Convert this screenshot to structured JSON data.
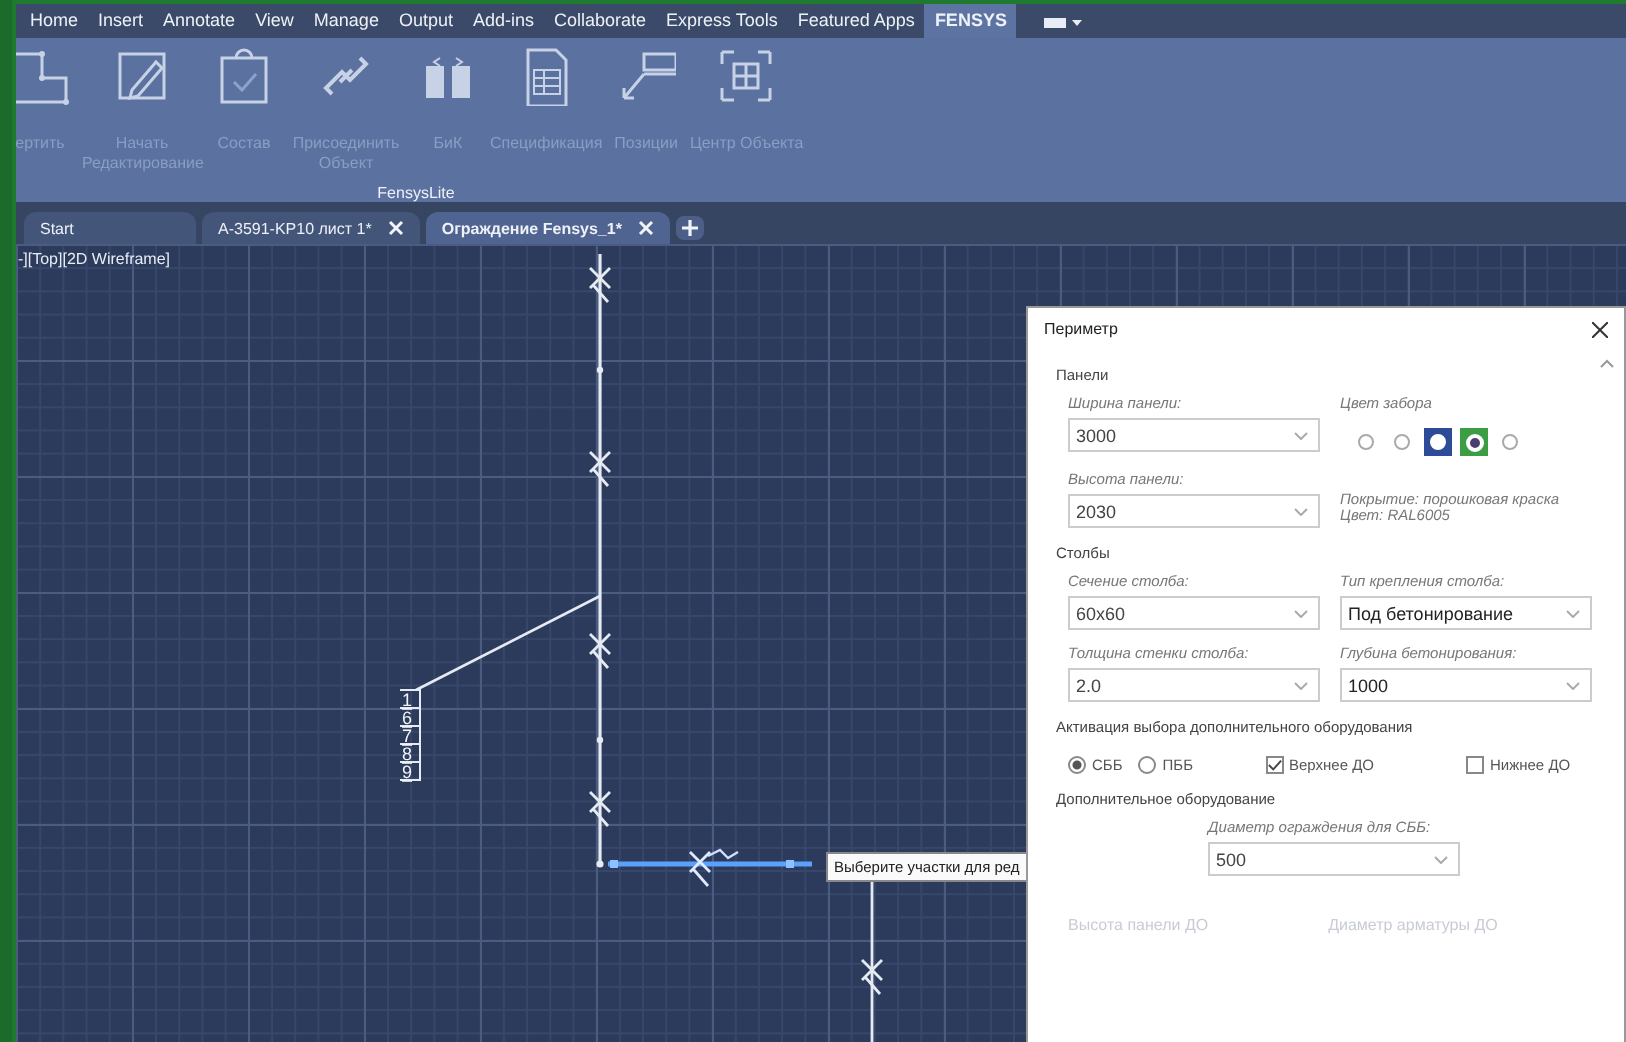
{
  "menu": [
    {
      "label": "Home",
      "selected": false
    },
    {
      "label": "Insert",
      "selected": false
    },
    {
      "label": "Annotate",
      "selected": false
    },
    {
      "label": "View",
      "selected": false
    },
    {
      "label": "Manage",
      "selected": false
    },
    {
      "label": "Output",
      "selected": false
    },
    {
      "label": "Add-ins",
      "selected": false
    },
    {
      "label": "Collaborate",
      "selected": false
    },
    {
      "label": "Express Tools",
      "selected": false
    },
    {
      "label": "Featured Apps",
      "selected": false
    },
    {
      "label": "FENSYS",
      "selected": true
    }
  ],
  "ribbon": {
    "buttons": [
      {
        "label": "ертить"
      },
      {
        "label": "Начать Редактирование"
      },
      {
        "label": "Состав"
      },
      {
        "label": "Присоединить Объект"
      },
      {
        "label": "БиК"
      },
      {
        "label": "Спецификация"
      },
      {
        "label": "Позиции"
      },
      {
        "label": "Центр Объекта"
      }
    ],
    "panel_title": "FensysLite"
  },
  "doc_tabs": [
    {
      "label": "Start",
      "selected": false,
      "closable": false
    },
    {
      "label": "A-3591-KP10 лист 1*",
      "selected": false,
      "closable": true
    },
    {
      "label": "Ограждение Fensys_1*",
      "selected": true,
      "closable": true
    }
  ],
  "viewport": {
    "label": "-][Top][2D Wireframe]",
    "leader_numbers": [
      "1",
      "6",
      "7",
      "8",
      "9"
    ],
    "tooltip": "Выберите участки для ред"
  },
  "dialog": {
    "title": "Периметр",
    "panels": {
      "heading": "Панели",
      "width": {
        "label": "Ширина панели:",
        "value": "3000"
      },
      "height": {
        "label": "Высота панели:",
        "value": "2030"
      },
      "color_label": "Цвет забора",
      "color_options": [
        {
          "selected": false
        },
        {
          "selected": false
        },
        {
          "color": "#2d4b97",
          "selected": false
        },
        {
          "color": "#3b9e45",
          "selected": true
        },
        {
          "selected": false
        }
      ],
      "coating_note": "Покрытие:   порошковая краска",
      "color_note": "Цвет:  RAL6005"
    },
    "posts": {
      "heading": "Столбы",
      "fields": [
        {
          "label": "Сечение столба:",
          "value": "60x60"
        },
        {
          "label": "Тип крепления столба:",
          "value": "Под бетонирование"
        },
        {
          "label": "Толщина стенки столба:",
          "value": "2.0"
        },
        {
          "label": "Глубина бетонирования:",
          "value": "1000"
        }
      ]
    },
    "activation": {
      "heading": "Активация выбора дополнительного оборудования",
      "options": [
        {
          "kind": "radio",
          "label": "СББ",
          "selected": true
        },
        {
          "kind": "radio",
          "label": "ПББ",
          "selected": false
        },
        {
          "kind": "checkbox",
          "label": "Верхнее ДО",
          "checked": true
        },
        {
          "kind": "checkbox",
          "label": "Нижнее ДО",
          "checked": false
        }
      ]
    },
    "extra": {
      "heading": "Дополнительное оборудование",
      "field": {
        "label": "Диаметр ограждения для СББ:",
        "value": "500"
      },
      "disabled_labels": [
        "Высота панели ДО",
        "Диаметр арматуры ДО"
      ]
    }
  }
}
